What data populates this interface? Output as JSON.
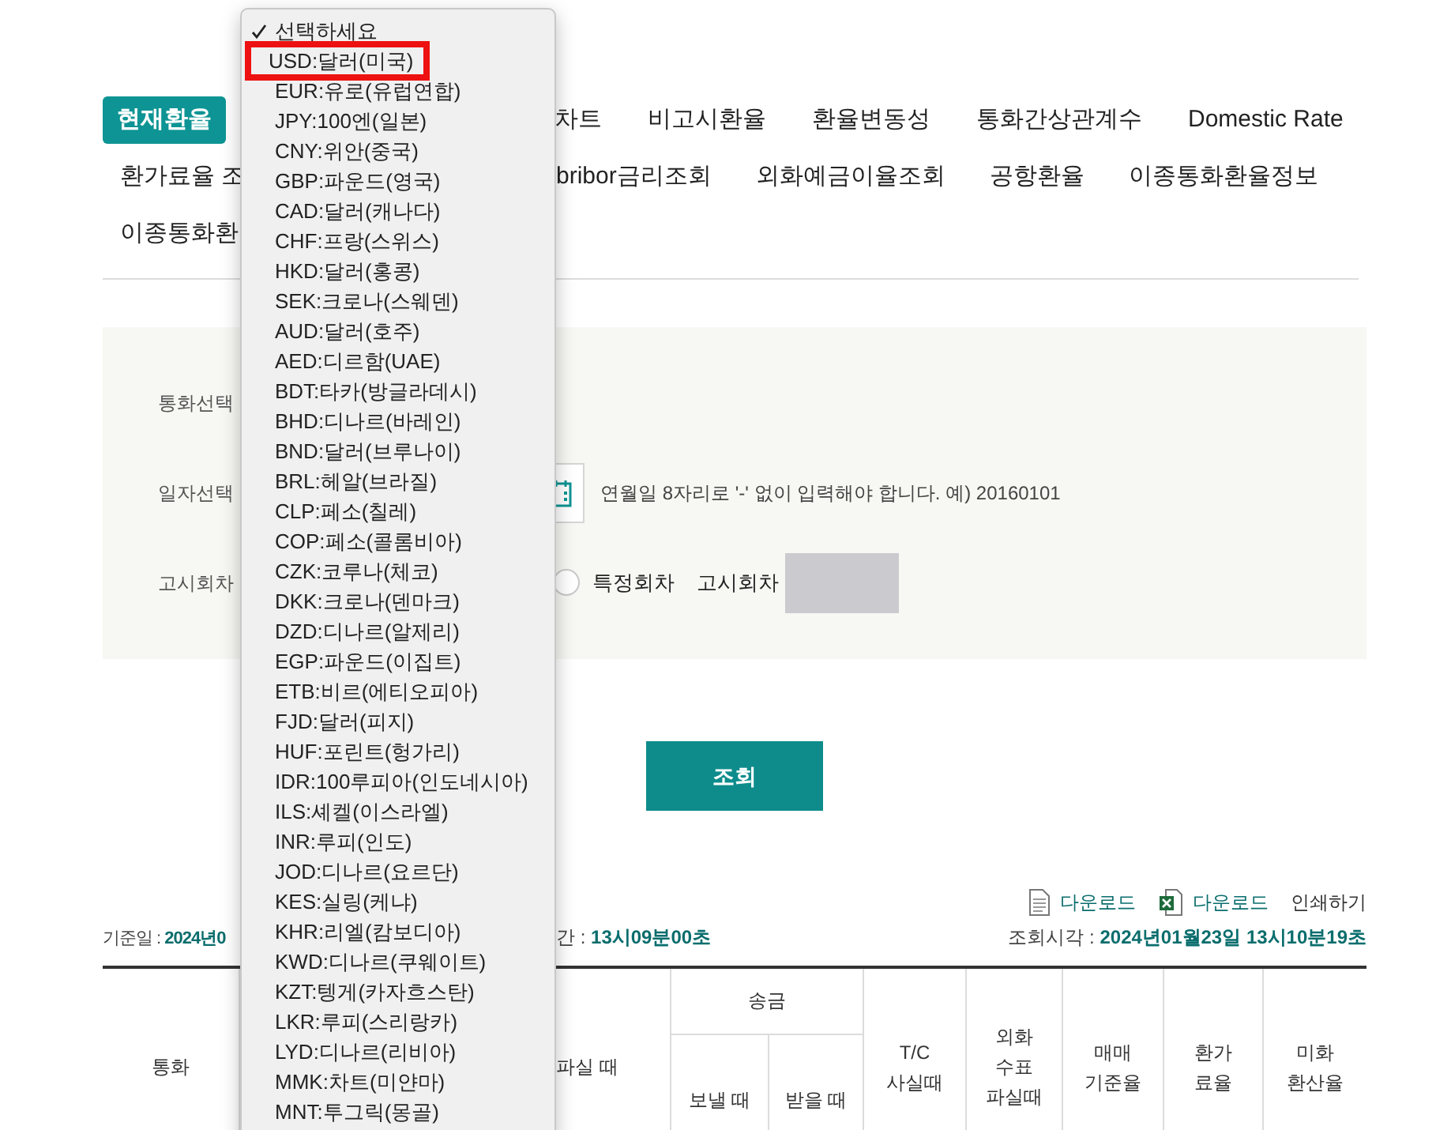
{
  "tab_rows": [
    [
      {
        "label": "현재환율",
        "selected": true
      },
      {
        "label": "차트",
        "selected": false
      },
      {
        "label": "비고시환율",
        "selected": false
      },
      {
        "label": "환율변동성",
        "selected": false
      },
      {
        "label": "통화간상관계수",
        "selected": false
      },
      {
        "label": "Domestic Rate",
        "selected": false
      }
    ],
    [
      {
        "label": "환가료율 조",
        "selected": false
      },
      {
        "label": "bribor금리조회",
        "selected": false
      },
      {
        "label": "외화예금이율조회",
        "selected": false
      },
      {
        "label": "공항환율",
        "selected": false
      },
      {
        "label": "이종통화환율정보",
        "selected": false
      }
    ],
    [
      {
        "label": "이종통화환",
        "selected": false
      }
    ]
  ],
  "form": {
    "currency_label": "통화선택",
    "date_label": "일자선택",
    "date_hint": "연월일 8자리로 '-' 없이 입력해야 합니다. 예) 20160101",
    "round_label": "고시회차",
    "round_option": {
      "label": "특정회차",
      "selected": false
    },
    "round_field_label": "고시회차"
  },
  "search_button": "조회",
  "actions": [
    {
      "kind": "document",
      "label": "다운로드"
    },
    {
      "kind": "excel",
      "label": "다운로드"
    },
    {
      "kind": "plain",
      "label": "인쇄하기"
    }
  ],
  "info": {
    "base_date_label": "기준일 : ",
    "base_date": "2024년0",
    "time_label": "간 : ",
    "time": "13시09분00초",
    "query_label": "조회시각 : ",
    "query_time": "2024년01월23일 13시10분19초"
  },
  "table": {
    "col_currency": "통화",
    "col_cash_sell": "파실 때",
    "group_remit": "송금",
    "col_remit_send": "보낼 때",
    "col_remit_receive": "받을 때",
    "col_tc": "T/C\n사실때",
    "col_check": "외화\n수표\n파실때",
    "col_base": "매매\n기준율",
    "col_fee": "환가\n료율",
    "col_usd": "미화\n환산율"
  },
  "dropdown": {
    "items": [
      {
        "label": "선택하세요",
        "selected": true,
        "highlighted": false
      },
      {
        "label": "USD:달러(미국)",
        "selected": false,
        "highlighted": true
      },
      {
        "label": "EUR:유로(유럽연합)",
        "selected": false,
        "highlighted": false
      },
      {
        "label": "JPY:100엔(일본)",
        "selected": false,
        "highlighted": false
      },
      {
        "label": "CNY:위안(중국)",
        "selected": false,
        "highlighted": false
      },
      {
        "label": "GBP:파운드(영국)",
        "selected": false,
        "highlighted": false
      },
      {
        "label": "CAD:달러(캐나다)",
        "selected": false,
        "highlighted": false
      },
      {
        "label": "CHF:프랑(스위스)",
        "selected": false,
        "highlighted": false
      },
      {
        "label": "HKD:달러(홍콩)",
        "selected": false,
        "highlighted": false
      },
      {
        "label": "SEK:크로나(스웨덴)",
        "selected": false,
        "highlighted": false
      },
      {
        "label": "AUD:달러(호주)",
        "selected": false,
        "highlighted": false
      },
      {
        "label": "AED:디르함(UAE)",
        "selected": false,
        "highlighted": false
      },
      {
        "label": "BDT:타카(방글라데시)",
        "selected": false,
        "highlighted": false
      },
      {
        "label": "BHD:디나르(바레인)",
        "selected": false,
        "highlighted": false
      },
      {
        "label": "BND:달러(브루나이)",
        "selected": false,
        "highlighted": false
      },
      {
        "label": "BRL:헤알(브라질)",
        "selected": false,
        "highlighted": false
      },
      {
        "label": "CLP:페소(칠레)",
        "selected": false,
        "highlighted": false
      },
      {
        "label": "COP:페소(콜롬비아)",
        "selected": false,
        "highlighted": false
      },
      {
        "label": "CZK:코루나(체코)",
        "selected": false,
        "highlighted": false
      },
      {
        "label": "DKK:크로나(덴마크)",
        "selected": false,
        "highlighted": false
      },
      {
        "label": "DZD:디나르(알제리)",
        "selected": false,
        "highlighted": false
      },
      {
        "label": "EGP:파운드(이집트)",
        "selected": false,
        "highlighted": false
      },
      {
        "label": "ETB:비르(에티오피아)",
        "selected": false,
        "highlighted": false
      },
      {
        "label": "FJD:달러(피지)",
        "selected": false,
        "highlighted": false
      },
      {
        "label": "HUF:포린트(헝가리)",
        "selected": false,
        "highlighted": false
      },
      {
        "label": "IDR:100루피아(인도네시아)",
        "selected": false,
        "highlighted": false
      },
      {
        "label": "ILS:셰켈(이스라엘)",
        "selected": false,
        "highlighted": false
      },
      {
        "label": "INR:루피(인도)",
        "selected": false,
        "highlighted": false
      },
      {
        "label": "JOD:디나르(요르단)",
        "selected": false,
        "highlighted": false
      },
      {
        "label": "KES:실링(케냐)",
        "selected": false,
        "highlighted": false
      },
      {
        "label": "KHR:리엘(캄보디아)",
        "selected": false,
        "highlighted": false
      },
      {
        "label": "KWD:디나르(쿠웨이트)",
        "selected": false,
        "highlighted": false
      },
      {
        "label": "KZT:텡게(카자흐스탄)",
        "selected": false,
        "highlighted": false
      },
      {
        "label": "LKR:루피(스리랑카)",
        "selected": false,
        "highlighted": false
      },
      {
        "label": "LYD:디나르(리비아)",
        "selected": false,
        "highlighted": false
      },
      {
        "label": "MMK:차트(미얀마)",
        "selected": false,
        "highlighted": false
      },
      {
        "label": "MNT:투그릭(몽골)",
        "selected": false,
        "highlighted": false
      }
    ]
  }
}
